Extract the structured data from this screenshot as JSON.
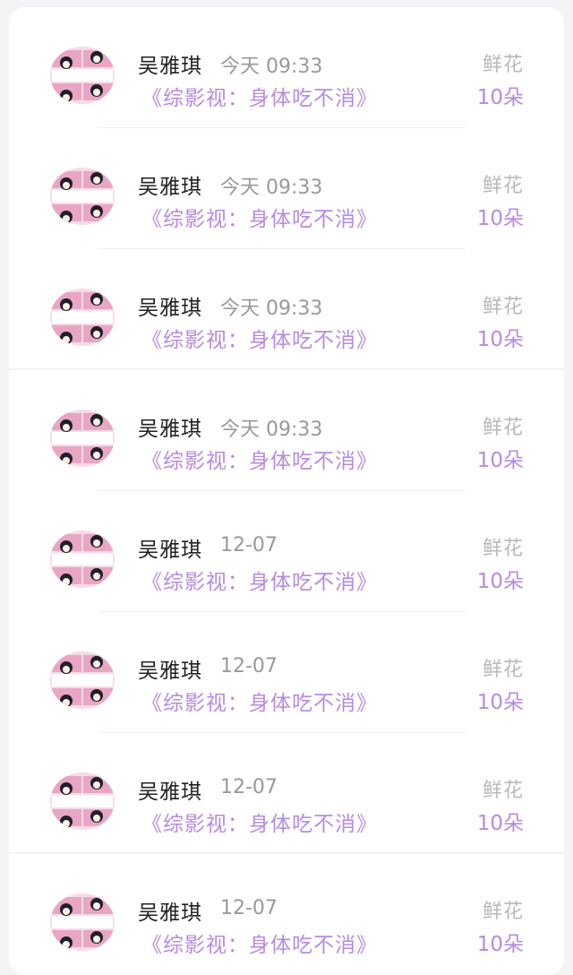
{
  "list": {
    "rows": [
      {
        "name": "吴雅琪",
        "time": "今天 09:33",
        "book": "《综影视：身体吃不消》",
        "gift_type": "鲜花",
        "gift_count": "10朵"
      },
      {
        "name": "吴雅琪",
        "time": "今天 09:33",
        "book": "《综影视：身体吃不消》",
        "gift_type": "鲜花",
        "gift_count": "10朵"
      },
      {
        "name": "吴雅琪",
        "time": "今天 09:33",
        "book": "《综影视：身体吃不消》",
        "gift_type": "鲜花",
        "gift_count": "10朵"
      },
      {
        "name": "吴雅琪",
        "time": "今天 09:33",
        "book": "《综影视：身体吃不消》",
        "gift_type": "鲜花",
        "gift_count": "10朵"
      },
      {
        "name": "吴雅琪",
        "time": "12-07",
        "book": "《综影视：身体吃不消》",
        "gift_type": "鲜花",
        "gift_count": "10朵"
      },
      {
        "name": "吴雅琪",
        "time": "12-07",
        "book": "《综影视：身体吃不消》",
        "gift_type": "鲜花",
        "gift_count": "10朵"
      },
      {
        "name": "吴雅琪",
        "time": "12-07",
        "book": "《综影视：身体吃不消》",
        "gift_type": "鲜花",
        "gift_count": "10朵"
      },
      {
        "name": "吴雅琪",
        "time": "12-07",
        "book": "《综影视：身体吃不消》",
        "gift_type": "鲜花",
        "gift_count": "10朵"
      }
    ]
  },
  "colors": {
    "accent": "#b88ae0",
    "name_text": "#222222",
    "muted_text": "#999999",
    "avatar_pink": "#e9a6c4"
  },
  "icons": {
    "avatar": "cartoon-girl-avatar"
  }
}
